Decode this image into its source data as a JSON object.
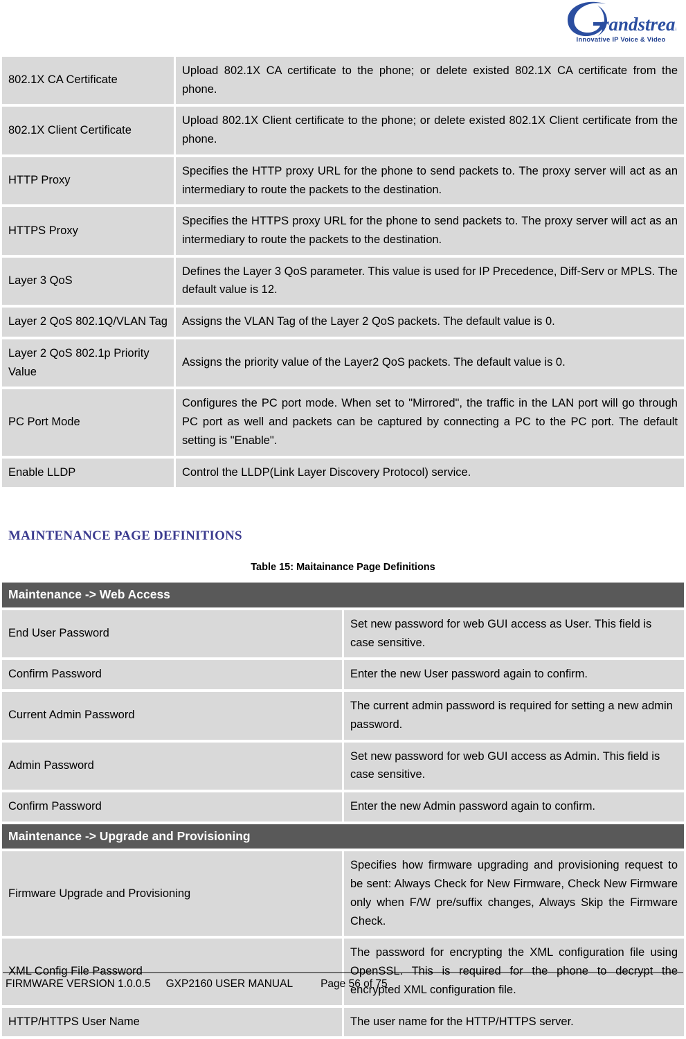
{
  "header": {
    "logo_name": "Grandstream",
    "logo_tagline": "Innovative IP Voice & Video"
  },
  "network_table": {
    "rows": [
      {
        "label": "802.1X CA Certificate",
        "desc": "Upload 802.1X CA certificate to the phone; or delete existed 802.1X CA certificate from the phone."
      },
      {
        "label": "802.1X Client Certificate",
        "desc": "Upload 802.1X Client certificate to the phone; or delete existed 802.1X Client certificate from the phone."
      },
      {
        "label": "HTTP Proxy",
        "desc": "Specifies the HTTP proxy URL for the phone to send packets to. The proxy server will act as an intermediary to route the packets to the destination."
      },
      {
        "label": "HTTPS Proxy",
        "desc": "Specifies the HTTPS proxy URL for the phone to send packets to. The proxy server will act as an intermediary to route the packets to the destination."
      },
      {
        "label": "Layer 3 QoS",
        "desc": "Defines the Layer 3 QoS parameter. This value is used for IP Precedence, Diff-Serv or MPLS. The default value is 12."
      },
      {
        "label": "Layer 2 QoS 802.1Q/VLAN Tag",
        "desc": "Assigns the VLAN Tag of the Layer 2 QoS packets. The default value is 0."
      },
      {
        "label": "Layer 2 QoS 802.1p Priority Value",
        "desc": "Assigns the priority value of the Layer2 QoS packets. The default value is 0."
      },
      {
        "label": "PC Port Mode",
        "desc": "Configures the PC port mode. When set to \"Mirrored\", the traffic in the LAN port will go through PC port as well and packets can be captured by connecting a PC to the PC port. The default setting is \"Enable\"."
      },
      {
        "label": "Enable LLDP",
        "desc": "Control the LLDP(Link Layer Discovery Protocol) service."
      }
    ]
  },
  "maintenance_section": {
    "heading": "MAINTENANCE PAGE DEFINITIONS",
    "caption": "Table 15: Maitainance Page Definitions",
    "web_access_header": "Maintenance -> Web Access",
    "web_access_rows": [
      {
        "label": "End User Password",
        "desc": "Set new password for web GUI access as User. This field is case sensitive."
      },
      {
        "label": "Confirm Password",
        "desc": "Enter the new User password again to confirm."
      },
      {
        "label": "Current Admin Password",
        "desc": "The current admin password is required for setting a new admin password."
      },
      {
        "label": "Admin Password",
        "desc": "Set new password for web GUI access as Admin. This field is case sensitive."
      },
      {
        "label": "Confirm Password",
        "desc": "Enter the new Admin password again to confirm."
      }
    ],
    "upgrade_header": "Maintenance -> Upgrade and Provisioning",
    "upgrade_rows": [
      {
        "label": "Firmware Upgrade and Provisioning",
        "desc": "Specifies how firmware upgrading and provisioning request to be sent: Always Check for New Firmware, Check New Firmware only when F/W pre/suffix changes, Always Skip the Firmware Check."
      },
      {
        "label": "XML Config File Password",
        "desc": "The password for encrypting the XML configuration file using OpenSSL. This is required for the phone to decrypt the encrypted XML configuration file."
      },
      {
        "label": "HTTP/HTTPS User Name",
        "desc": "The user name for the HTTP/HTTPS server."
      }
    ]
  },
  "footer": {
    "firmware": "FIRMWARE VERSION 1.0.0.5",
    "manual": "GXP2160 USER MANUAL",
    "page": "Page 56 of 75"
  }
}
